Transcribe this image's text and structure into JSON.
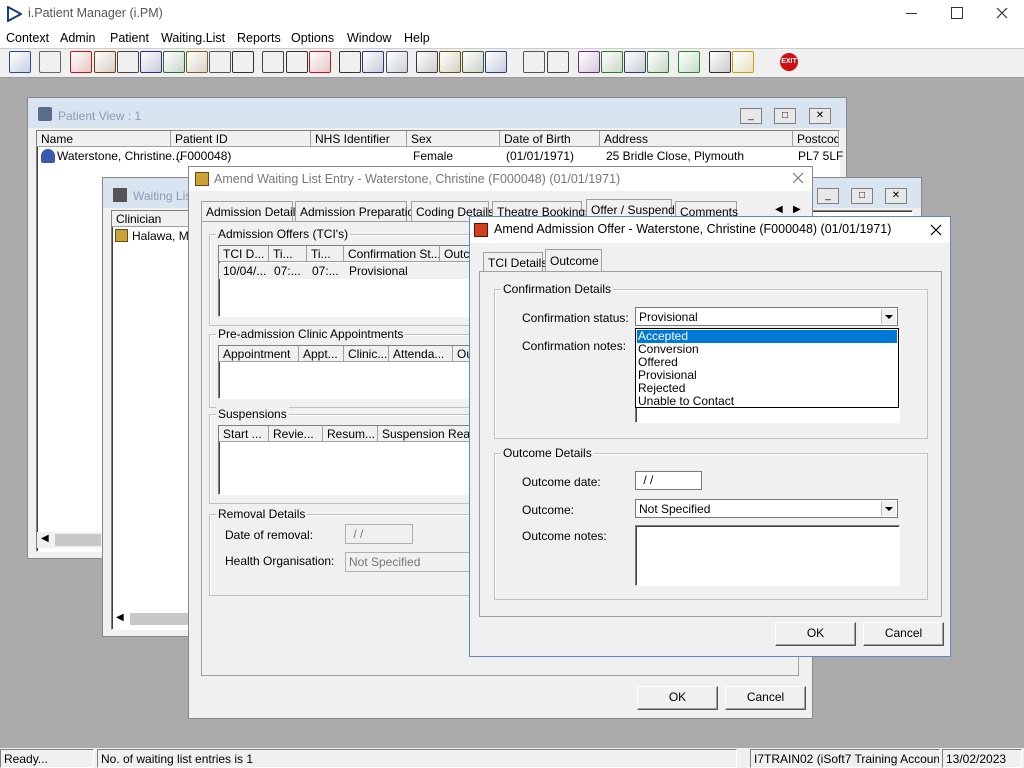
{
  "app": {
    "title": "i.Patient Manager (i.PM)",
    "menu": [
      "Context",
      "Admin",
      "Patient",
      "Waiting.List",
      "Reports",
      "Options",
      "Window",
      "Help"
    ]
  },
  "toolbar": {
    "icons": [
      "user-icon",
      "printer-icon",
      "book-icon",
      "notes-icon",
      "list-icon",
      "letter-m-icon",
      "person-icon",
      "document-icon",
      "pen-icon",
      "car-icon",
      "ambulance-icon",
      "scissors-icon",
      "clock-icon",
      "monitor-icon",
      "calendar-icon",
      "form-icon",
      "stopwatch-icon",
      "clipboard-icon",
      "checklist-icon",
      "transfer-icon",
      "stamp-icon",
      "page-icon",
      "chart-icon",
      "globe-icon",
      "note-edit-icon",
      "check-doc-icon",
      "refresh-icon",
      "download-icon",
      "swap-icon",
      "warning-icon",
      "exit-icon"
    ],
    "exit_label": "EXIT"
  },
  "patient_view": {
    "title": "Patient View : 1",
    "columns": [
      "Name",
      "Patient ID",
      "NHS Identifier",
      "Sex",
      "Date of Birth",
      "Address",
      "Postcod"
    ],
    "row": {
      "name": "Waterstone, Christine...",
      "id": "(F000048)",
      "nhs": "",
      "sex": "Female",
      "dob": "(01/01/1971)",
      "address": "25 Bridle Close, Plymouth",
      "postcode": "PL7 5LF"
    }
  },
  "waiting_list": {
    "title": "Waiting Lis",
    "col_clinician": "Clinician",
    "row_clinician": "Halawa, Mr"
  },
  "amend_wl": {
    "title": "Amend Waiting List Entry - Waterstone, Christine (F000048) (01/01/1971)",
    "tabs": [
      "Admission Details",
      "Admission Preparation",
      "Coding Details",
      "Theatre Bookings",
      "Offer / Suspend",
      "Comments"
    ],
    "tci_group": "Admission Offers (TCI's)",
    "tci_cols": [
      "TCI D...",
      "Ti...",
      "Ti...",
      "Confirmation St...",
      "Outc"
    ],
    "tci_row": [
      "10/04/...",
      "07:...",
      "07:...",
      "Provisional"
    ],
    "preadm_group": "Pre-admission Clinic Appointments",
    "preadm_cols": [
      "Appointment",
      "Appt...",
      "Clinic...",
      "Attenda...",
      "Ou"
    ],
    "susp_group": "Suspensions",
    "susp_cols": [
      "Start ...",
      "Revie...",
      "Resum...",
      "Suspension Reaso"
    ],
    "removal_group": "Removal Details",
    "date_removal_label": "Date of removal:",
    "date_removal_value": " / /",
    "health_org_label": "Health Organisation:",
    "health_org_value": "Not Specified",
    "ok": "OK",
    "cancel": "Cancel"
  },
  "amend_offer": {
    "title": "Amend Admission Offer  - Waterstone, Christine (F000048) (01/01/1971)",
    "tabs": [
      "TCI Details",
      "Outcome"
    ],
    "confirmation_group": "Confirmation Details",
    "conf_status_label": "Confirmation status:",
    "conf_status_value": "Provisional",
    "conf_notes_label": "Confirmation notes:",
    "options": [
      "Accepted",
      "Conversion",
      "Offered",
      "Provisional",
      "Rejected",
      "Unable to Contact"
    ],
    "highlighted_option": "Accepted",
    "outcome_group": "Outcome Details",
    "outcome_date_label": "Outcome date:",
    "outcome_date_value": " / /",
    "outcome_label": "Outcome:",
    "outcome_value": "Not Specified",
    "outcome_notes_label": "Outcome notes:",
    "ok": "OK",
    "cancel": "Cancel"
  },
  "status_bar": {
    "ready": "Ready...",
    "entries": "No. of waiting list entries is 1",
    "account": "I7TRAIN02 (iSoft7 Training Account)",
    "date": "13/02/2023"
  }
}
